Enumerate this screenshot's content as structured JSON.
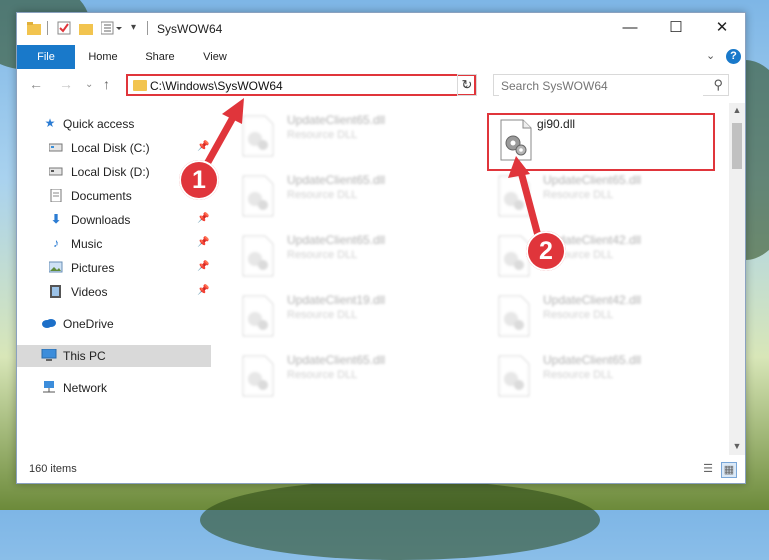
{
  "window": {
    "title": "SysWOW64"
  },
  "ribbon": {
    "tabs": [
      "File",
      "Home",
      "Share",
      "View"
    ]
  },
  "address": {
    "path": "C:\\Windows\\SysWOW64"
  },
  "search": {
    "placeholder": "Search SysWOW64"
  },
  "sidebar": {
    "items": [
      {
        "label": "Quick access",
        "icon": "star-icon",
        "pinned": false
      },
      {
        "label": "Local Disk (C:)",
        "icon": "drive-icon",
        "pinned": true
      },
      {
        "label": "Local Disk (D:)",
        "icon": "drive-icon",
        "pinned": false
      },
      {
        "label": "Documents",
        "icon": "documents-icon",
        "pinned": false
      },
      {
        "label": "Downloads",
        "icon": "download-icon",
        "pinned": true
      },
      {
        "label": "Music",
        "icon": "music-icon",
        "pinned": true
      },
      {
        "label": "Pictures",
        "icon": "pictures-icon",
        "pinned": true
      },
      {
        "label": "Videos",
        "icon": "videos-icon",
        "pinned": true
      },
      {
        "label": "OneDrive",
        "icon": "cloud-icon",
        "pinned": false
      },
      {
        "label": "This PC",
        "icon": "computer-icon",
        "pinned": false
      },
      {
        "label": "Network",
        "icon": "network-icon",
        "pinned": false
      }
    ]
  },
  "files": {
    "left": [
      {
        "name": "UpdateClient65.dll",
        "type": "Resource DLL"
      },
      {
        "name": "UpdateClient65.dll",
        "type": "Resource DLL"
      },
      {
        "name": "UpdateClient65.dll",
        "type": "Resource DLL"
      },
      {
        "name": "UpdateClient19.dll",
        "type": "Resource DLL"
      },
      {
        "name": "UpdateClient65.dll",
        "type": "Resource DLL"
      }
    ],
    "right": [
      {
        "name": "gi90.dll",
        "type": ""
      },
      {
        "name": "UpdateClient65.dll",
        "type": "Resource DLL"
      },
      {
        "name": "UpdateClient42.dll",
        "type": "Resource DLL"
      },
      {
        "name": "UpdateClient42.dll",
        "type": "Resource DLL"
      },
      {
        "name": "UpdateClient65.dll",
        "type": "Resource DLL"
      }
    ]
  },
  "status": {
    "item_count": "160 items"
  },
  "annotations": {
    "step1": "1",
    "step2": "2",
    "color": "#e0353b"
  },
  "colors": {
    "accent": "#1979ca",
    "highlight": "#e0353b",
    "folder": "#f2c44f"
  }
}
